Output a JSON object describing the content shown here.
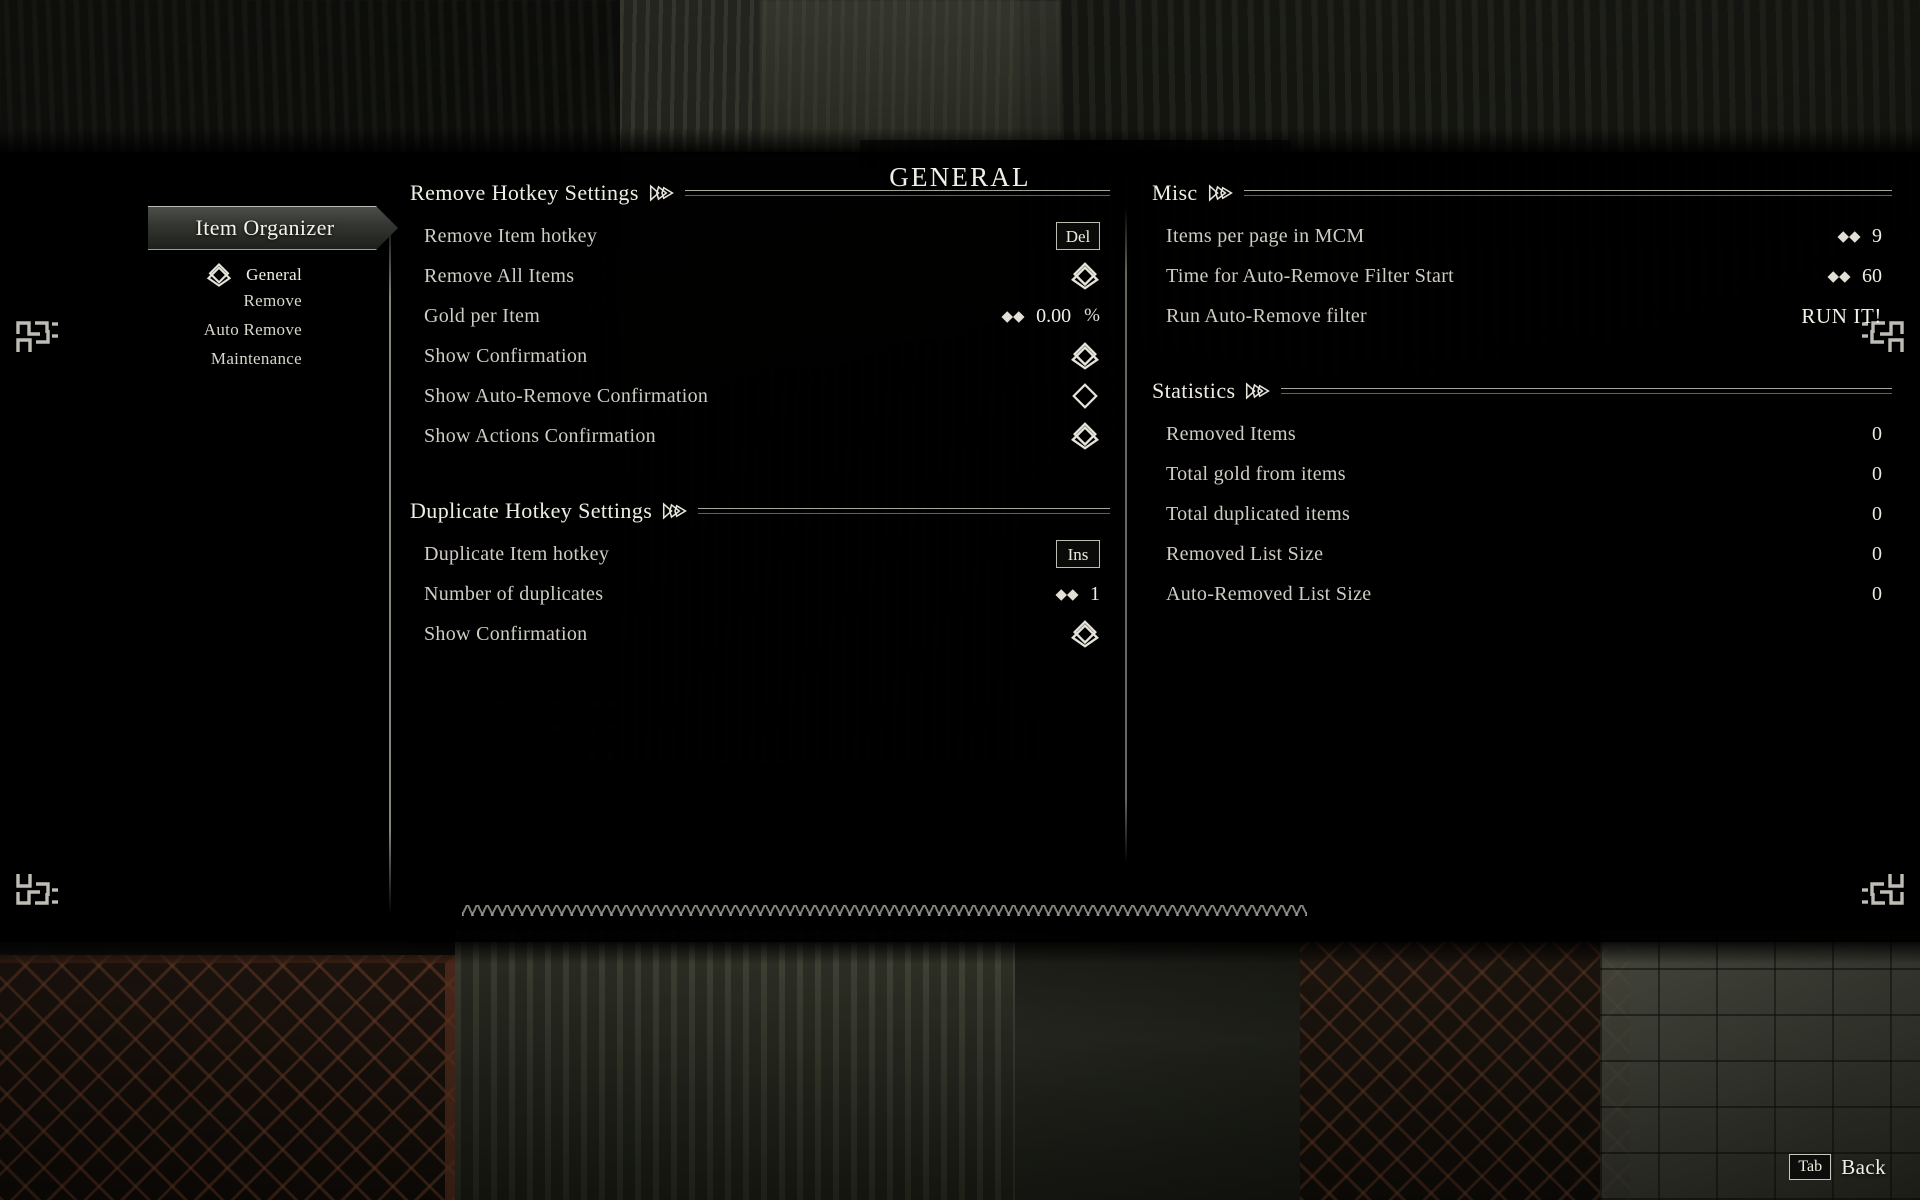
{
  "header": {
    "title": "GENERAL"
  },
  "sidebar": {
    "mod_title": "Item Organizer",
    "items": [
      {
        "label": "General",
        "selected": true
      },
      {
        "label": "Remove",
        "selected": false
      },
      {
        "label": "Auto Remove",
        "selected": false
      },
      {
        "label": "Maintenance",
        "selected": false
      }
    ]
  },
  "left_column": {
    "sections": [
      {
        "title": "Remove Hotkey Settings",
        "options": [
          {
            "label": "Remove Item hotkey",
            "type": "keybind",
            "value": "Del"
          },
          {
            "label": "Remove All Items",
            "type": "checkbox",
            "checked": true
          },
          {
            "label": "Gold per Item",
            "type": "slider",
            "value": "0.00",
            "unit": "%"
          },
          {
            "label": "Show Confirmation",
            "type": "checkbox",
            "checked": true
          },
          {
            "label": "Show Auto-Remove Confirmation",
            "type": "checkbox",
            "checked": false
          },
          {
            "label": "Show Actions Confirmation",
            "type": "checkbox",
            "checked": true
          }
        ]
      },
      {
        "title": "Duplicate Hotkey Settings",
        "options": [
          {
            "label": "Duplicate Item hotkey",
            "type": "keybind",
            "value": "Ins"
          },
          {
            "label": "Number of duplicates",
            "type": "slider",
            "value": "1",
            "unit": ""
          },
          {
            "label": "Show Confirmation",
            "type": "checkbox",
            "checked": true
          }
        ]
      }
    ]
  },
  "right_column": {
    "sections": [
      {
        "title": "Misc",
        "options": [
          {
            "label": "Items per page in MCM",
            "type": "slider",
            "value": "9",
            "unit": ""
          },
          {
            "label": "Time for Auto-Remove Filter Start",
            "type": "slider",
            "value": "60",
            "unit": ""
          },
          {
            "label": "Run Auto-Remove filter",
            "type": "action",
            "value": "RUN IT!"
          }
        ]
      },
      {
        "title": "Statistics",
        "options": [
          {
            "label": "Removed Items",
            "type": "text",
            "value": "0"
          },
          {
            "label": "Total gold from items",
            "type": "text",
            "value": "0"
          },
          {
            "label": "Total duplicated items",
            "type": "text",
            "value": "0"
          },
          {
            "label": "Removed List Size",
            "type": "text",
            "value": "0"
          },
          {
            "label": "Auto-Removed List Size",
            "type": "text",
            "value": "0"
          }
        ]
      }
    ]
  },
  "footer": {
    "key": "Tab",
    "label": "Back"
  },
  "icons": {
    "selection_knot": "knot-diamond-icon",
    "section_knot": "pennant-knot-icon",
    "slider_arrows": "double-diamond-arrows-icon",
    "corner": "interlace-corner-icon"
  },
  "colors": {
    "panel_bg": "#000000",
    "text_primary": "#f0eee4",
    "text_secondary": "#cfcdc3",
    "rule": "#c4c6ba"
  }
}
